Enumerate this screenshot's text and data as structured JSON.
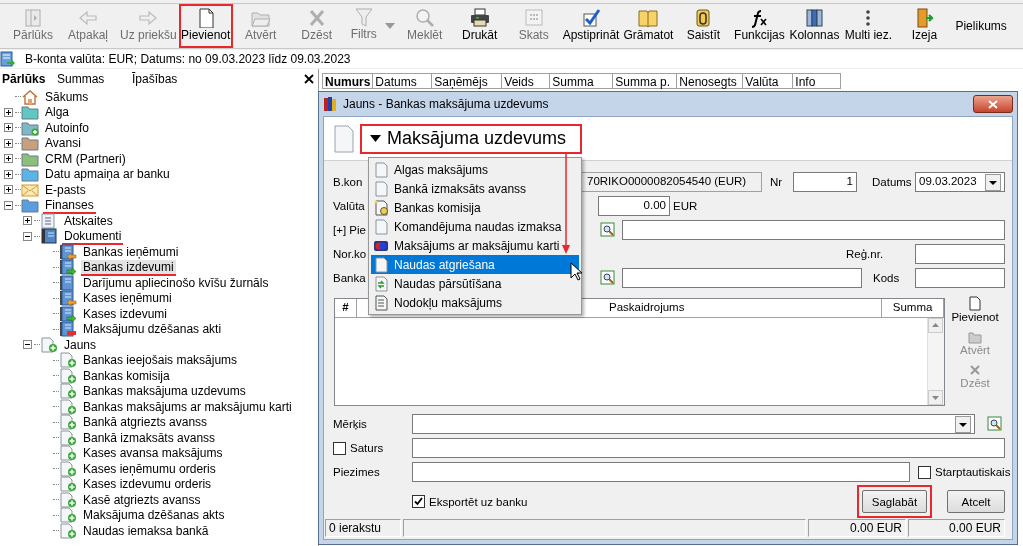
{
  "toolbar": [
    {
      "label": "Pārlūks",
      "kind": "button",
      "disabled": true,
      "highlighted": false
    },
    {
      "label": "Atpakaļ",
      "kind": "button",
      "disabled": true,
      "highlighted": false
    },
    {
      "label": "Uz priekšu",
      "kind": "button",
      "disabled": true,
      "highlighted": false
    },
    {
      "label": "Pievienot",
      "kind": "button",
      "disabled": false,
      "highlighted": true
    },
    {
      "label": "Atvērt",
      "kind": "button",
      "disabled": true,
      "highlighted": false
    },
    {
      "label": "Dzēst",
      "kind": "button",
      "disabled": true,
      "highlighted": false
    },
    {
      "label": "Filtrs",
      "kind": "split",
      "disabled": true,
      "highlighted": false
    },
    {
      "label": "Meklēt",
      "kind": "button",
      "disabled": true,
      "highlighted": false
    },
    {
      "label": "Drukāt",
      "kind": "button",
      "disabled": false,
      "highlighted": false
    },
    {
      "label": "Skats",
      "kind": "button",
      "disabled": true,
      "highlighted": false
    },
    {
      "label": "Apstiprināt",
      "kind": "button",
      "disabled": false,
      "highlighted": false
    },
    {
      "label": "Grāmatot",
      "kind": "button",
      "disabled": false,
      "highlighted": false
    },
    {
      "label": "Saistīt",
      "kind": "button",
      "disabled": false,
      "highlighted": false
    },
    {
      "label": "Funkcijas",
      "kind": "button",
      "disabled": false,
      "highlighted": false
    },
    {
      "label": "Kolonnas",
      "kind": "button",
      "disabled": false,
      "highlighted": false
    },
    {
      "label": "Multi iez.",
      "kind": "button",
      "disabled": false,
      "highlighted": false
    },
    {
      "label": "Izeja",
      "kind": "button",
      "disabled": false,
      "highlighted": false
    },
    {
      "label": "Pielikums",
      "kind": "text",
      "disabled": false,
      "highlighted": false
    }
  ],
  "info_bar": {
    "text": "B-konta valūta: EUR; Datums: no 09.03.2023 līdz 09.03.2023"
  },
  "navigator": {
    "tabs": [
      {
        "label": "Pārlūks",
        "selected": true
      },
      {
        "label": "Summas",
        "selected": false
      },
      {
        "label": "Īpašības",
        "selected": false
      }
    ],
    "items": [
      {
        "label": "Sākums",
        "kind": "home",
        "selected": false,
        "marked": false
      },
      {
        "label": "Alga",
        "kind": "folder",
        "color": "#5fc8c0",
        "expanded": false,
        "selected": false,
        "marked": false
      },
      {
        "label": "Autoinfo",
        "kind": "folder-add",
        "color": "#7fb8c4",
        "expanded": false,
        "selected": false,
        "marked": false
      },
      {
        "label": "Avansi",
        "kind": "folder",
        "color": "#c9a07c",
        "expanded": false,
        "selected": false,
        "marked": false
      },
      {
        "label": "CRM (Partneri)",
        "kind": "folder",
        "color": "#8cc07a",
        "expanded": false,
        "selected": false,
        "marked": false
      },
      {
        "label": "Datu apmaiņa ar banku",
        "kind": "folder",
        "color": "#5ab4e8",
        "expanded": false,
        "selected": false,
        "marked": false
      },
      {
        "label": "E-pasts",
        "kind": "mail",
        "expanded": false,
        "selected": false,
        "marked": false
      },
      {
        "label": "Finanses",
        "kind": "folder",
        "color": "#5a9ee0",
        "expanded": true,
        "selected": false,
        "marked": true,
        "children": [
          {
            "label": "Atskaites",
            "kind": "report",
            "expanded": false,
            "selected": false,
            "marked": false
          },
          {
            "label": "Dokumenti",
            "kind": "book",
            "expanded": true,
            "selected": false,
            "marked": true,
            "children": [
              {
                "label": "Bankas ieņēmumi",
                "kind": "doc-in",
                "selected": false,
                "marked": false
              },
              {
                "label": "Bankas izdevumi",
                "kind": "doc-out",
                "selected": true,
                "marked": true
              },
              {
                "label": "Darījumu apliecinošo kvīšu žurnāls",
                "kind": "doc",
                "selected": false,
                "marked": false
              },
              {
                "label": "Kases ieņēmumi",
                "kind": "doc-in",
                "selected": false,
                "marked": false
              },
              {
                "label": "Kases izdevumi",
                "kind": "doc-out",
                "selected": false,
                "marked": false
              },
              {
                "label": "Maksājumu dzēšanas akti",
                "kind": "doc-remove",
                "selected": false,
                "marked": false
              }
            ]
          },
          {
            "label": "Jauns",
            "kind": "new",
            "expanded": true,
            "selected": false,
            "marked": false,
            "children": [
              {
                "label": "Bankas ieejošais maksājums",
                "kind": "new",
                "selected": false,
                "marked": false
              },
              {
                "label": "Bankas komisija",
                "kind": "new",
                "selected": false,
                "marked": false
              },
              {
                "label": "Bankas maksājuma uzdevums",
                "kind": "new",
                "selected": false,
                "marked": false
              },
              {
                "label": "Bankas maksājums ar maksājumu karti",
                "kind": "new",
                "selected": false,
                "marked": false
              },
              {
                "label": "Bankā atgriezts avanss",
                "kind": "new",
                "selected": false,
                "marked": false
              },
              {
                "label": "Bankā izmaksāts avanss",
                "kind": "new",
                "selected": false,
                "marked": false
              },
              {
                "label": "Kases avansa maksājums",
                "kind": "new",
                "selected": false,
                "marked": false
              },
              {
                "label": "Kases ieņēmumu orderis",
                "kind": "new",
                "selected": false,
                "marked": false
              },
              {
                "label": "Kases izdevumu orderis",
                "kind": "new",
                "selected": false,
                "marked": false
              },
              {
                "label": "Kasē atgriezts avanss",
                "kind": "new",
                "selected": false,
                "marked": false
              },
              {
                "label": "Maksājuma dzēšanas akts",
                "kind": "new",
                "selected": false,
                "marked": false
              },
              {
                "label": "Naudas iemaksa bankā",
                "kind": "new",
                "selected": false,
                "marked": false
              }
            ]
          }
        ]
      }
    ]
  },
  "list": {
    "columns": [
      {
        "label": "Numurs",
        "sorted": true
      },
      {
        "label": "Datums",
        "sorted": false
      },
      {
        "label": "Saņēmējs",
        "sorted": false
      },
      {
        "label": "Veids",
        "sorted": false
      },
      {
        "label": "Summa",
        "sorted": false
      },
      {
        "label": "Summa p.",
        "sorted": false
      },
      {
        "label": "Nenosegts",
        "sorted": false
      },
      {
        "label": "Valūta",
        "sorted": false
      },
      {
        "label": "Info",
        "sorted": false
      }
    ]
  },
  "dialog": {
    "title": "Jauns - Bankas maksājuma uzdevums",
    "heading": {
      "label": "Maksājuma uzdevums",
      "highlighted": true
    },
    "pointer_arrow": true,
    "type_menu": [
      {
        "label": "Algas maksājums",
        "selected": false
      },
      {
        "label": "Bankā izmaksāts avanss",
        "selected": false
      },
      {
        "label": "Bankas komisija",
        "selected": false
      },
      {
        "label": "Komandējuma naudas izmaksa",
        "selected": false
      },
      {
        "label": "Maksājums ar maksājumu karti",
        "selected": false
      },
      {
        "label": "Naudas atgriešana",
        "selected": true
      },
      {
        "label": "Naudas pārsūtīšana",
        "selected": false
      },
      {
        "label": "Nodokļu maksājums",
        "selected": false
      }
    ],
    "form": {
      "account": {
        "label": "B.kon",
        "value": "70RIKO0000082054540 (EUR)"
      },
      "number": {
        "label": "Nr",
        "value": "1"
      },
      "date": {
        "label": "Datums",
        "value": "09.03.2023"
      },
      "currency": {
        "label": "Valūta",
        "value": "0.00",
        "unit": "EUR"
      },
      "recipient": {
        "label": "[+] Pie"
      },
      "reg_code": {
        "label": "Nor.ko"
      },
      "reg_number": {
        "label": "Reģ.nr."
      },
      "bank": {
        "label": "Banka"
      },
      "bank_code": {
        "label": "Kods"
      },
      "purpose": {
        "label": "Mērķis"
      },
      "content": {
        "label": "Saturs",
        "checked": false
      },
      "notes": {
        "label": "Piezimes"
      },
      "international": {
        "label": "Starptautiskais",
        "checked": false
      },
      "export": {
        "label": "Eksportēt uz banku",
        "checked": true
      }
    },
    "lines_grid": {
      "columns": [
        "#",
        "Paskaidrojums",
        "Summa"
      ]
    },
    "line_buttons": [
      {
        "label": "Pievienot",
        "disabled": false
      },
      {
        "label": "Atvērt",
        "disabled": true
      },
      {
        "label": "Dzēst",
        "disabled": true
      }
    ],
    "buttons": [
      {
        "label": "Saglabāt",
        "highlighted": true
      },
      {
        "label": "Atcelt",
        "highlighted": false
      }
    ],
    "status_bar": [
      "0 ierakstu",
      "0.00 EUR",
      "0.00 EUR"
    ]
  }
}
